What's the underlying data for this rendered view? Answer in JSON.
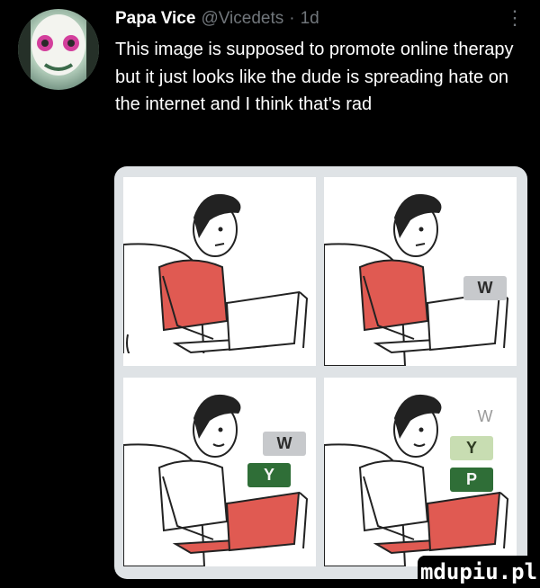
{
  "tweet": {
    "author_name": "Papa Vice",
    "author_handle": "@Vicedets",
    "separator": "·",
    "timestamp": "1d",
    "more_label": "⋮",
    "text": "This image is supposed to promote online therapy but it just looks like the dude is spreading hate on the internet and I think that's rad"
  },
  "panels": [
    {
      "shirt_color": "#e05a52",
      "laptop_screen": "#ffffff",
      "stickers": []
    },
    {
      "shirt_color": "#e05a52",
      "laptop_screen": "#ffffff",
      "stickers": [
        "W"
      ]
    },
    {
      "shirt_color": "#ffffff",
      "laptop_screen": "#e05a52",
      "stickers": [
        "W",
        "Y"
      ]
    },
    {
      "shirt_color": "#ffffff",
      "laptop_screen": "#e05a52",
      "stickers": [
        "W",
        "Y",
        "P"
      ]
    }
  ],
  "stickers": {
    "p2_w": "W",
    "p3_w": "W",
    "p3_y": "Y",
    "p4_w": "W",
    "p4_y": "Y",
    "p4_p": "P"
  },
  "watermark": "mdupiu.pl",
  "colors": {
    "background": "#000000",
    "name": "#ffffff",
    "muted": "#71767b",
    "shirt_red": "#e05a52",
    "sticker_green": "#2f6e37"
  },
  "icons": {
    "more": "more-vertical-icon"
  }
}
